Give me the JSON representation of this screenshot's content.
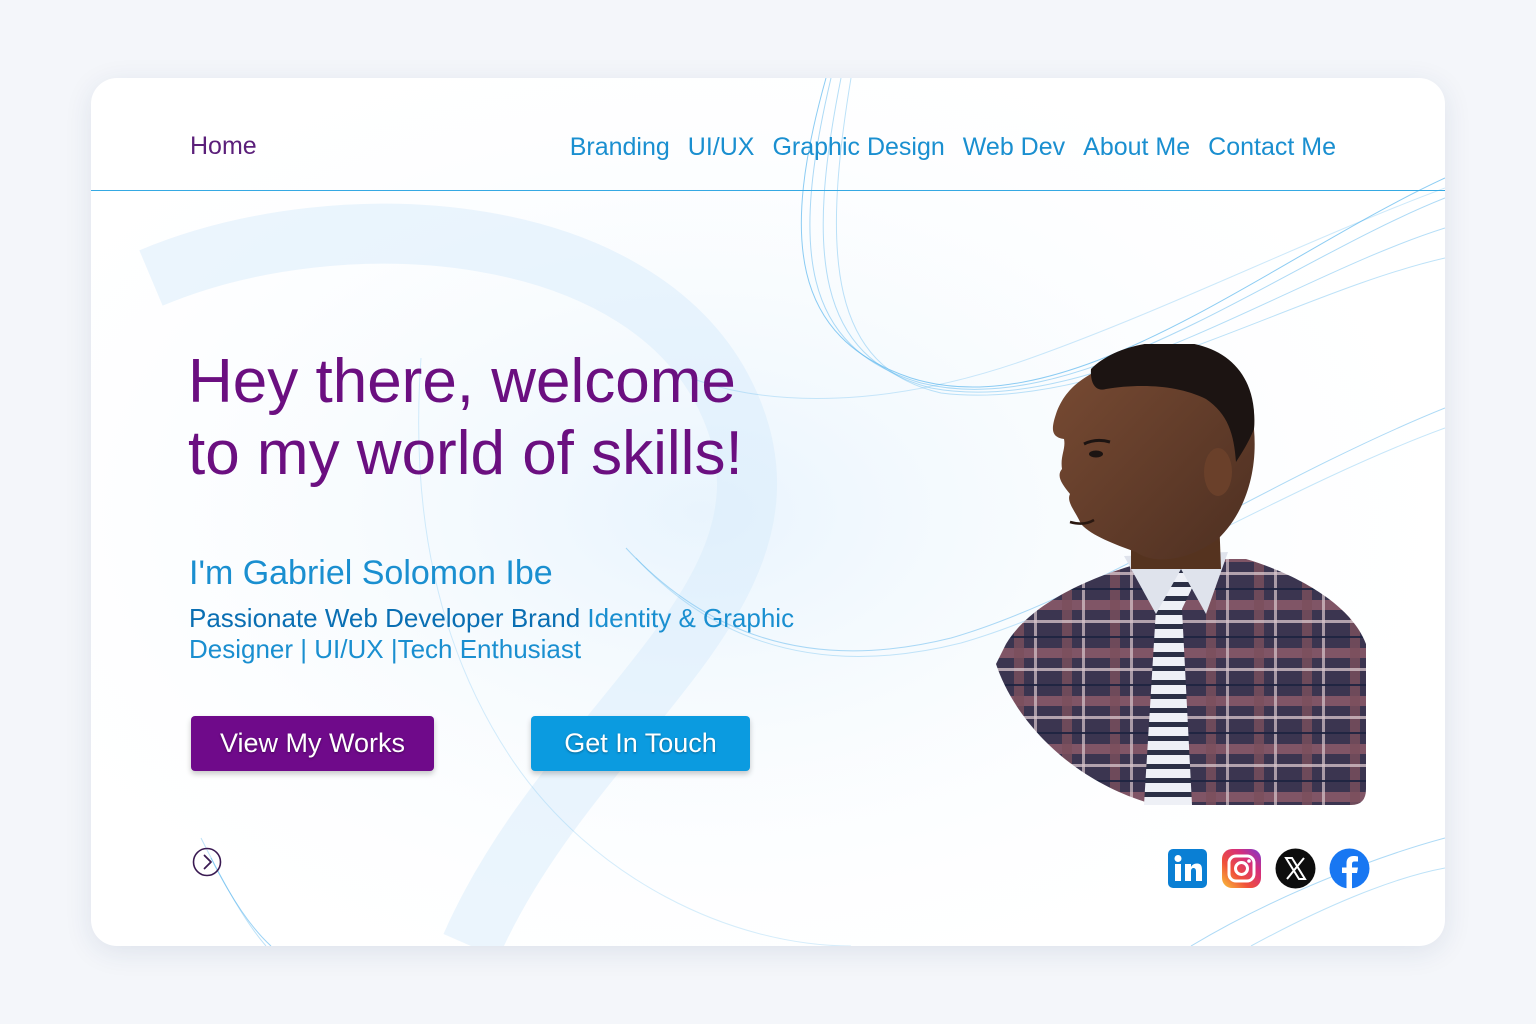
{
  "nav": {
    "home_label": "Home",
    "links": [
      "Branding",
      "UI/UX",
      "Graphic Design",
      "Web Dev",
      "About Me",
      "Contact Me"
    ]
  },
  "hero": {
    "title_line1": "Hey there, welcome",
    "title_line2": "to my world of skills!",
    "name_line": "I'm Gabriel Solomon Ibe",
    "tagline_strong": "Passionate Web Developer Brand ",
    "tagline_rest": "Identity & Graphic Designer | UI/UX |Tech Enthusiast"
  },
  "buttons": {
    "works_label": "View My Works",
    "touch_label": "Get In Touch"
  },
  "icons": {
    "scroll": "chevron-right-circle-icon",
    "socials": [
      "linkedin-icon",
      "instagram-icon",
      "x-icon",
      "facebook-icon"
    ]
  },
  "colors": {
    "primary_purple": "#6f0a8a",
    "accent_blue": "#0b9be0",
    "link_blue": "#1a8fd0"
  }
}
